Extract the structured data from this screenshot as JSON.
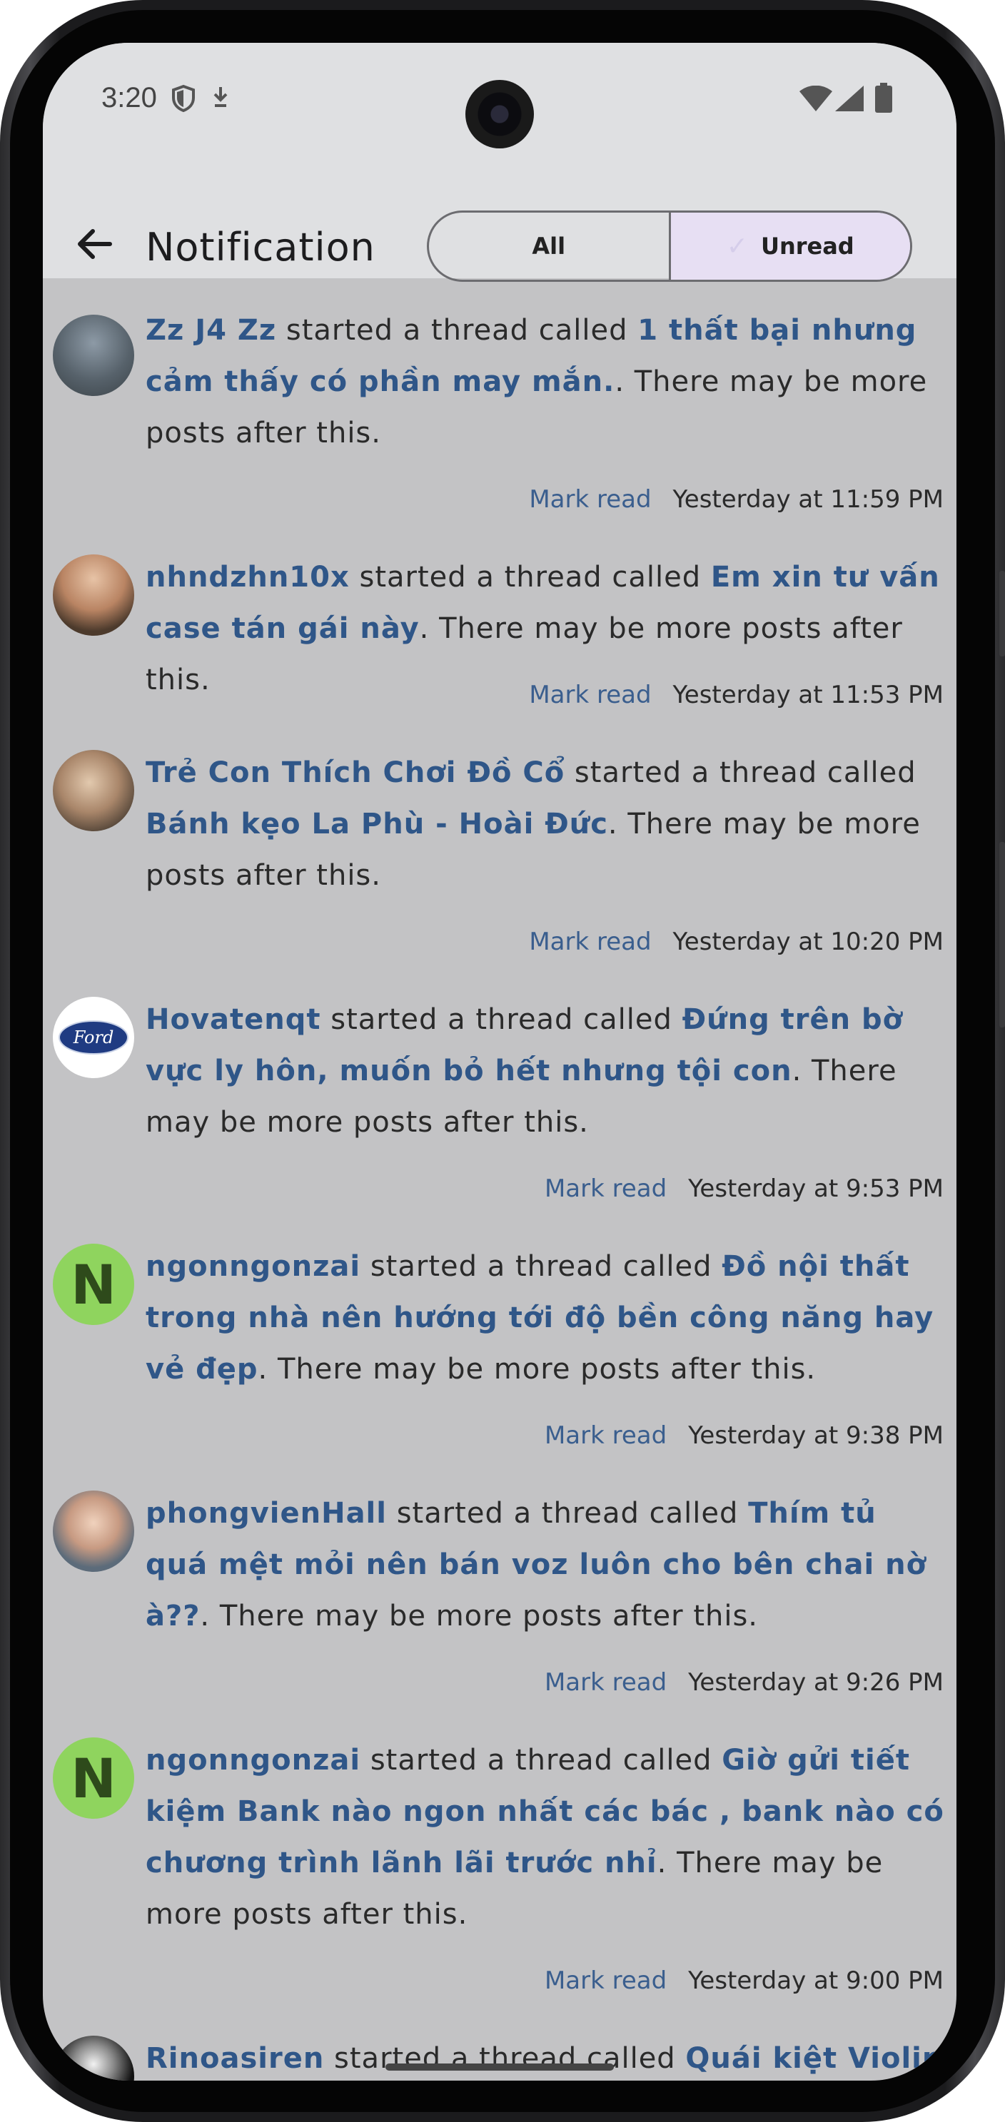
{
  "status": {
    "time": "3:20"
  },
  "appbar": {
    "title": "Notification",
    "tabs": [
      {
        "label": "All"
      },
      {
        "label": "Unread"
      }
    ]
  },
  "common": {
    "started": " started a thread called ",
    "more_prefix": ". There may be more posts after this.",
    "mark_read": "Mark read"
  },
  "notifications": [
    {
      "user": "Zz J4 Zz",
      "thread": "1 thất bại nhưng cảm thấy có phần may mắn.",
      "time": "Yesterday at 11:59 PM",
      "avatar": "photo"
    },
    {
      "user": "nhndzhn10x",
      "thread": "Em xin tư vấn case tán gái này",
      "time": "Yesterday at 11:53 PM",
      "avatar": "photo"
    },
    {
      "user": "Trẻ Con Thích Chơi Đồ Cổ",
      "thread": "Bánh kẹo La Phù - Hoài Đức",
      "time": "Yesterday at 10:20 PM",
      "avatar": "photo"
    },
    {
      "user": "Hovatenqt",
      "thread": "Đứng trên bờ vực ly hôn, muốn bỏ hết nhưng tội con",
      "time": "Yesterday at 9:53 PM",
      "avatar": "ford"
    },
    {
      "user": "ngonngonzai",
      "thread": "Đồ nội thất trong nhà nên hướng tới độ bền công năng hay vẻ đẹp",
      "time": "Yesterday at 9:38 PM",
      "avatar": "N"
    },
    {
      "user": "phongvienHall",
      "thread": "Thím tủ quá mệt mỏi nên bán voz luôn cho bên chai nờ à??",
      "time": "Yesterday at 9:26 PM",
      "avatar": "photo"
    },
    {
      "user": "ngonngonzai",
      "thread": "Giờ gửi tiết kiệm Bank nào ngon nhất các bác , bank nào có chương trình lãnh lãi trước nhỉ",
      "time": "Yesterday at 9:00 PM",
      "avatar": "N"
    },
    {
      "user": "Rinoasiren",
      "thread": "Quái kiệt Violin Tú Xìn kéo violin say đắm lòng người",
      "time": "",
      "avatar": "photo"
    }
  ]
}
